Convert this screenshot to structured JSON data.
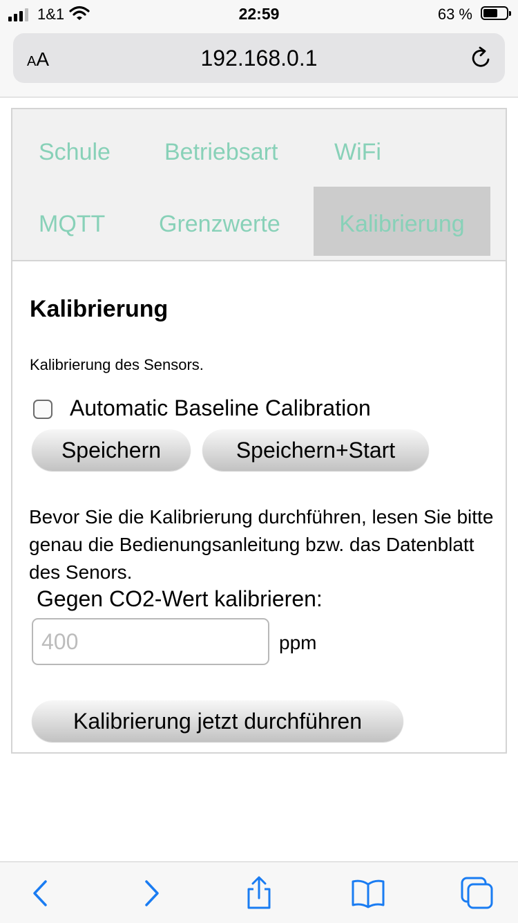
{
  "status_bar": {
    "carrier": "1&1",
    "time": "22:59",
    "battery_percent": "63 %",
    "battery_level": 0.63
  },
  "browser": {
    "text_size_button_small": "A",
    "text_size_button_large": "A",
    "url": "192.168.0.1"
  },
  "tabs": [
    {
      "label": "Schule",
      "active": false
    },
    {
      "label": "Betriebsart",
      "active": false
    },
    {
      "label": "WiFi",
      "active": false
    },
    {
      "label": "MQTT",
      "active": false
    },
    {
      "label": "Grenzwerte",
      "active": false
    },
    {
      "label": "Kalibrierung",
      "active": true
    }
  ],
  "colors": {
    "tab_text": "#88d1b8",
    "tab_active_bg": "#cccccc",
    "ios_blue": "#1a7cf2"
  },
  "calibration": {
    "heading": "Kalibrierung",
    "description": "Kalibrierung des Sensors.",
    "abc_label": "Automatic Baseline Calibration",
    "abc_checked": false,
    "save_button": "Speichern",
    "save_start_button": "Speichern+Start",
    "info_text": "Bevor Sie die Kalibrierung durchführen, lesen Sie bitte genau die Bedienungsanleitung bzw. das Datenblatt des Senors.",
    "co2_label": "Gegen CO2-Wert kalibrieren:",
    "co2_value": "",
    "co2_placeholder": "400",
    "co2_unit": "ppm",
    "run_button": "Kalibrierung jetzt durchführen"
  },
  "toolbar": {
    "icons": [
      "back-icon",
      "forward-icon",
      "share-icon",
      "bookmarks-icon",
      "tabs-icon"
    ]
  }
}
